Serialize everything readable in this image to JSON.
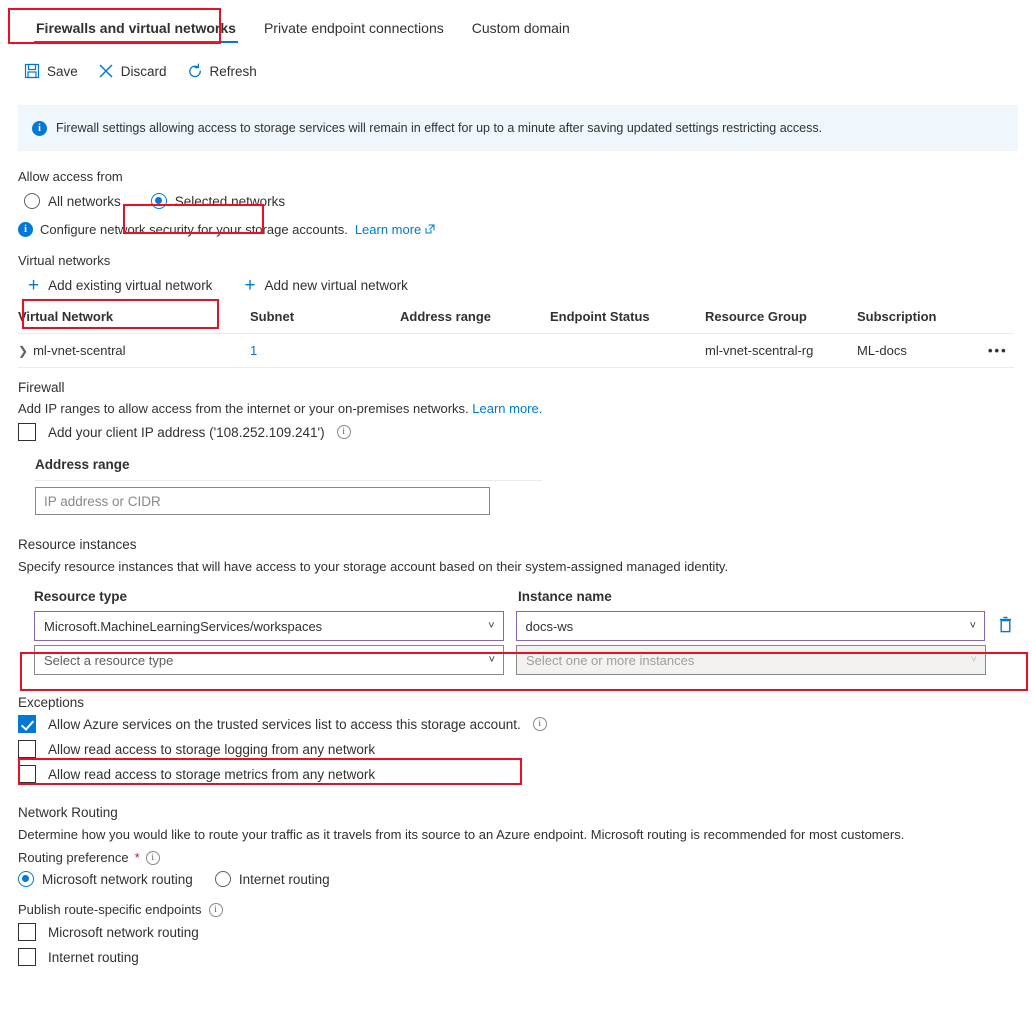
{
  "tabs": [
    {
      "label": "Firewalls and virtual networks",
      "active": true
    },
    {
      "label": "Private endpoint connections",
      "active": false
    },
    {
      "label": "Custom domain",
      "active": false
    }
  ],
  "toolbar": {
    "save_label": "Save",
    "discard_label": "Discard",
    "refresh_label": "Refresh"
  },
  "banner": {
    "text": "Firewall settings allowing access to storage services will remain in effect for up to a minute after saving updated settings restricting access."
  },
  "allow_access": {
    "label": "Allow access from",
    "options": [
      {
        "label": "All networks",
        "selected": false
      },
      {
        "label": "Selected networks",
        "selected": true
      }
    ],
    "note": "Configure network security for your storage accounts.",
    "note_link": "Learn more"
  },
  "virtual_networks": {
    "label": "Virtual networks",
    "add_existing_label": "Add existing virtual network",
    "add_new_label": "Add new virtual network",
    "columns": [
      "Virtual Network",
      "Subnet",
      "Address range",
      "Endpoint Status",
      "Resource Group",
      "Subscription"
    ],
    "rows": [
      {
        "name": "ml-vnet-scentral",
        "subnet": "1",
        "address_range": "",
        "endpoint_status": "",
        "resource_group": "ml-vnet-scentral-rg",
        "subscription": "ML-docs",
        "menu": "•••"
      }
    ]
  },
  "firewall": {
    "heading": "Firewall",
    "description": "Add IP ranges to allow access from the internet or your on-premises networks.",
    "description_link": "Learn more.",
    "client_ip_label": "Add your client IP address ('108.252.109.241')",
    "client_ip_checked": false,
    "address_range_label": "Address range",
    "address_range_value": "",
    "address_range_placeholder": "IP address or CIDR"
  },
  "resource_instances": {
    "heading": "Resource instances",
    "description": "Specify resource instances that will have access to your storage account based on their system-assigned managed identity.",
    "col_resource_type": "Resource type",
    "col_instance_name": "Instance name",
    "rows": [
      {
        "resource_type": "Microsoft.MachineLearningServices/workspaces",
        "instance_name": "docs-ws",
        "filled": true,
        "disabled": false
      },
      {
        "resource_type": "Select a resource type",
        "instance_name": "Select one or more instances",
        "filled": false,
        "disabled": true
      }
    ],
    "delete_icon": "trash-icon"
  },
  "exceptions": {
    "heading": "Exceptions",
    "items": [
      {
        "label": "Allow Azure services on the trusted services list to access this storage account.",
        "checked": true,
        "info": true
      },
      {
        "label": "Allow read access to storage logging from any network",
        "checked": false,
        "info": false
      },
      {
        "label": "Allow read access to storage metrics from any network",
        "checked": false,
        "info": false
      }
    ]
  },
  "network_routing": {
    "heading": "Network Routing",
    "description": "Determine how you would like to route your traffic as it travels from its source to an Azure endpoint. Microsoft routing is recommended for most customers.",
    "routing_preference_label": "Routing preference",
    "required_mark": "*",
    "preference_options": [
      {
        "label": "Microsoft network routing",
        "selected": true
      },
      {
        "label": "Internet routing",
        "selected": false
      }
    ],
    "publish_label": "Publish route-specific endpoints",
    "publish_options": [
      {
        "label": "Microsoft network routing",
        "checked": false
      },
      {
        "label": "Internet routing",
        "checked": false
      }
    ]
  },
  "colors": {
    "accent": "#0078d4",
    "annotation": "#e81123",
    "banner_bg": "#eff6fc",
    "filled_select_border": "#8764b8"
  }
}
